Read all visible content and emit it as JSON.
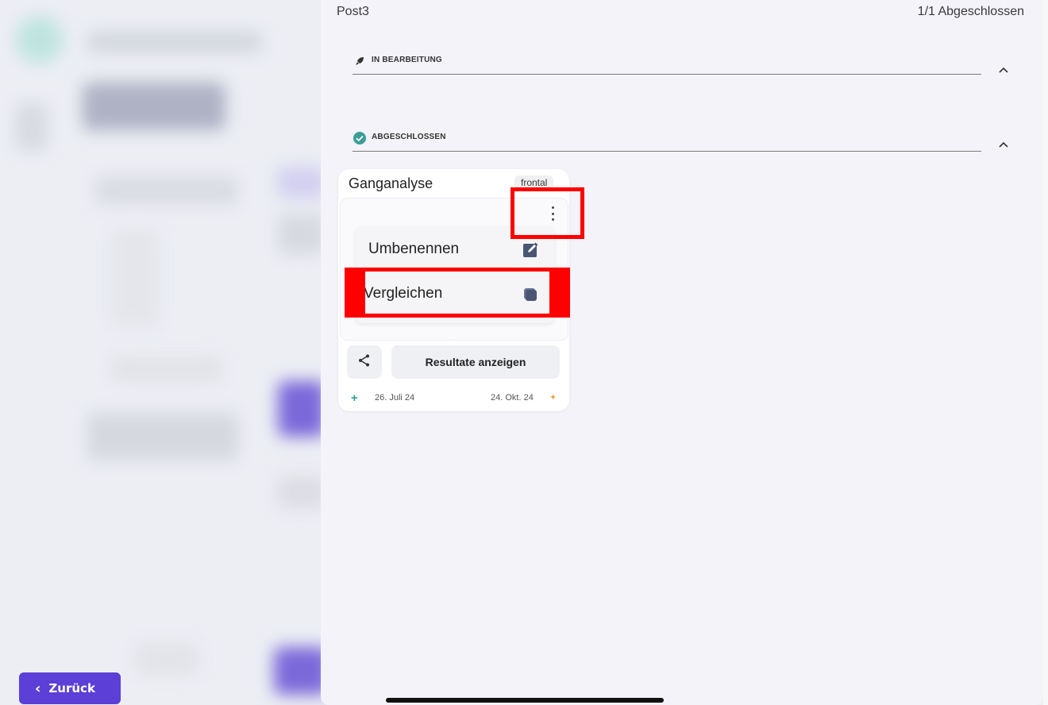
{
  "sheet": {
    "title": "Post3",
    "status": "1/1 Abgeschlossen"
  },
  "sections": [
    {
      "label": "IN BEARBEITUNG",
      "icon": "rocket-icon"
    },
    {
      "label": "ABGESCHLOSSEN",
      "icon": "check-circle-icon"
    }
  ],
  "card": {
    "title": "Ganganalyse",
    "badge": "frontal",
    "menu": [
      {
        "label": "Umbenennen",
        "icon": "edit-icon"
      },
      {
        "label": "Vergleichen",
        "icon": "compare-icon"
      }
    ],
    "results_label": "Resultate anzeigen",
    "created": "26. Juli 24",
    "modified": "24. Okt. 24"
  },
  "footer": {
    "back_label": "Zurück"
  },
  "colors": {
    "accent": "#5b3fd6",
    "teal": "#2f9c95",
    "highlight": "#ff0000"
  }
}
